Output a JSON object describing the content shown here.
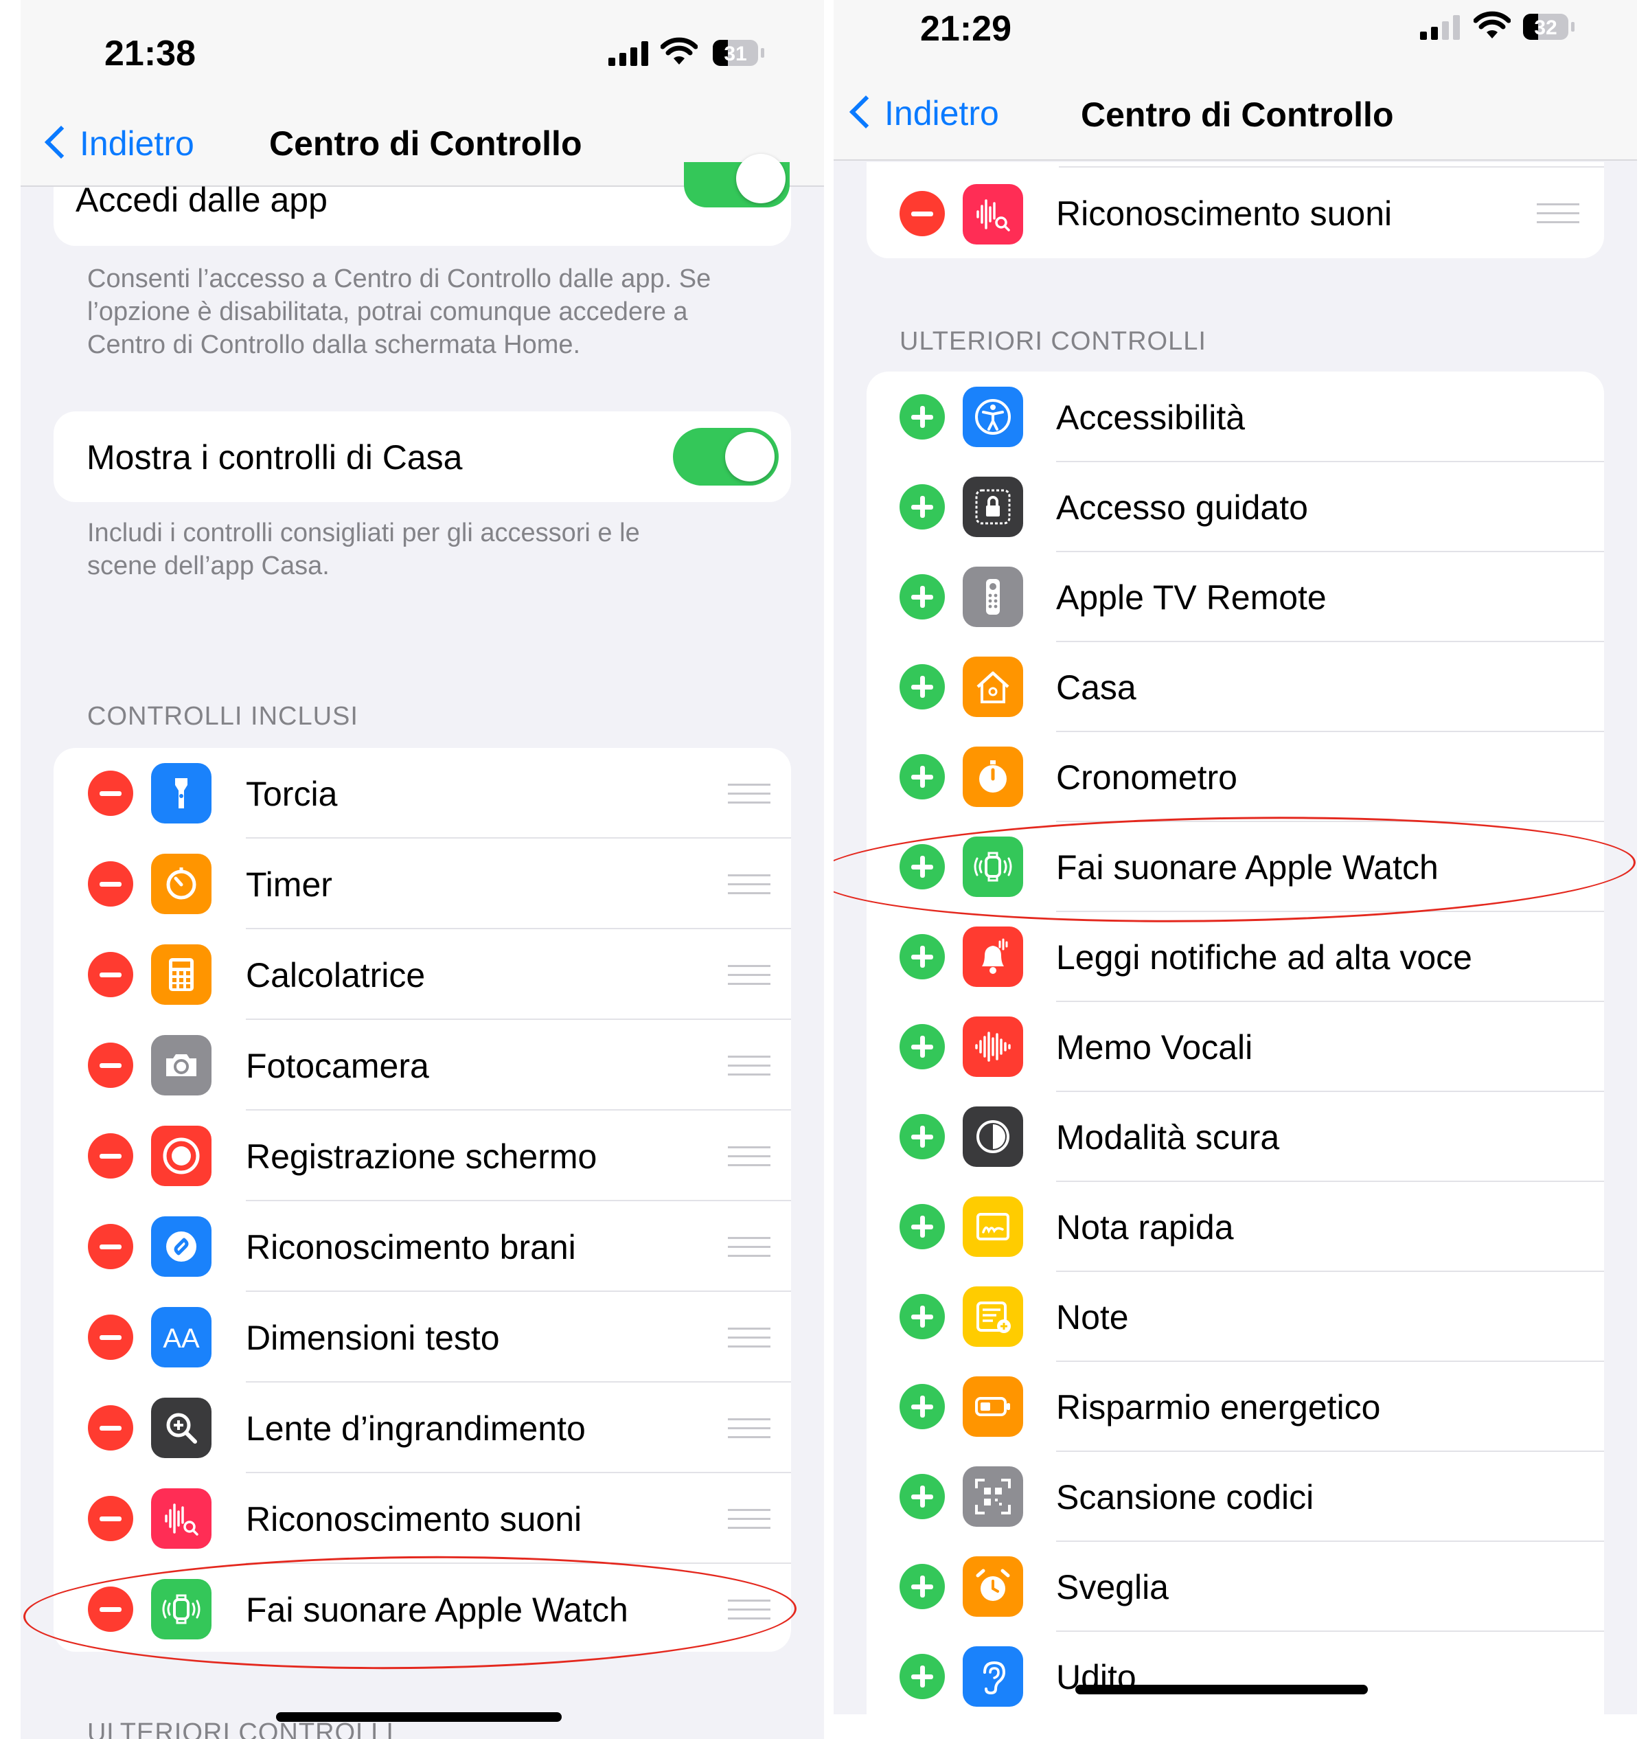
{
  "left": {
    "status": {
      "time": "21:38",
      "battery": "31"
    },
    "nav": {
      "back": "Indietro",
      "title": "Centro di Controllo"
    },
    "access_app": {
      "label": "Accedi dalle app",
      "on": true,
      "footer_lines": [
        "Consenti l’accesso a Centro di Controllo dalle app. Se",
        "l’opzione è disabilitata, potrai comunque accedere a",
        "Centro di Controllo dalla schermata Home."
      ]
    },
    "home_controls": {
      "label": "Mostra i controlli di Casa",
      "on": true,
      "footer_lines": [
        "Includi i controlli consigliati per gli accessori e le",
        "scene dell’app Casa."
      ]
    },
    "included_header": "CONTROLLI INCLUSI",
    "included": [
      {
        "label": "Torcia",
        "icon": "flashlight-icon",
        "color": "#1a82fb"
      },
      {
        "label": "Timer",
        "icon": "timer-icon",
        "color": "#ff9500"
      },
      {
        "label": "Calcolatrice",
        "icon": "calculator-icon",
        "color": "#ff9500"
      },
      {
        "label": "Fotocamera",
        "icon": "camera-icon",
        "color": "#8e8e93"
      },
      {
        "label": "Registrazione schermo",
        "icon": "record-icon",
        "color": "#ff3b30"
      },
      {
        "label": "Riconoscimento brani",
        "icon": "shazam-icon",
        "color": "#1a82fb"
      },
      {
        "label": "Dimensioni testo",
        "icon": "text-size-icon",
        "color": "#1a82fb",
        "glyph": "AA"
      },
      {
        "label": "Lente d’ingrandimento",
        "icon": "magnifier-icon",
        "color": "#3a3a3c"
      },
      {
        "label": "Riconoscimento suoni",
        "icon": "sound-recognition-icon",
        "color": "#ff2d55"
      },
      {
        "label": "Fai suonare Apple Watch",
        "icon": "ping-watch-icon",
        "color": "#34c759"
      }
    ],
    "more_header_partial": "ULTERIORI CONTROLLI"
  },
  "right": {
    "status": {
      "time": "21:29",
      "battery": "32"
    },
    "nav": {
      "back": "Indietro",
      "title": "Centro di Controllo"
    },
    "top_included": {
      "label": "Riconoscimento suoni",
      "icon": "sound-recognition-icon",
      "color": "#ff2d55"
    },
    "more_header": "ULTERIORI CONTROLLI",
    "more": [
      {
        "label": "Accessibilità",
        "icon": "accessibility-icon",
        "color": "#1a82fb"
      },
      {
        "label": "Accesso guidato",
        "icon": "guided-access-icon",
        "color": "#3a3a3c"
      },
      {
        "label": "Apple TV Remote",
        "icon": "remote-icon",
        "color": "#8e8e93"
      },
      {
        "label": "Casa",
        "icon": "home-icon",
        "color": "#ff9500"
      },
      {
        "label": "Cronometro",
        "icon": "stopwatch-icon",
        "color": "#ff9500"
      },
      {
        "label": "Fai suonare Apple Watch",
        "icon": "ping-watch-icon",
        "color": "#34c759"
      },
      {
        "label": "Leggi notifiche ad alta voce",
        "icon": "announce-notifications-icon",
        "color": "#ff3b30"
      },
      {
        "label": "Memo Vocali",
        "icon": "voice-memos-icon",
        "color": "#ff3b30"
      },
      {
        "label": "Modalità scura",
        "icon": "dark-mode-icon",
        "color": "#3a3a3c"
      },
      {
        "label": "Nota rapida",
        "icon": "quick-note-icon",
        "color": "#ffcc00"
      },
      {
        "label": "Note",
        "icon": "notes-icon",
        "color": "#ffcc00"
      },
      {
        "label": "Risparmio energetico",
        "icon": "low-power-icon",
        "color": "#ff9500"
      },
      {
        "label": "Scansione codici",
        "icon": "code-scanner-icon",
        "color": "#8e8e93"
      },
      {
        "label": "Sveglia",
        "icon": "alarm-icon",
        "color": "#ff9500"
      },
      {
        "label": "Udito",
        "icon": "hearing-icon",
        "color": "#1a82fb"
      }
    ]
  }
}
